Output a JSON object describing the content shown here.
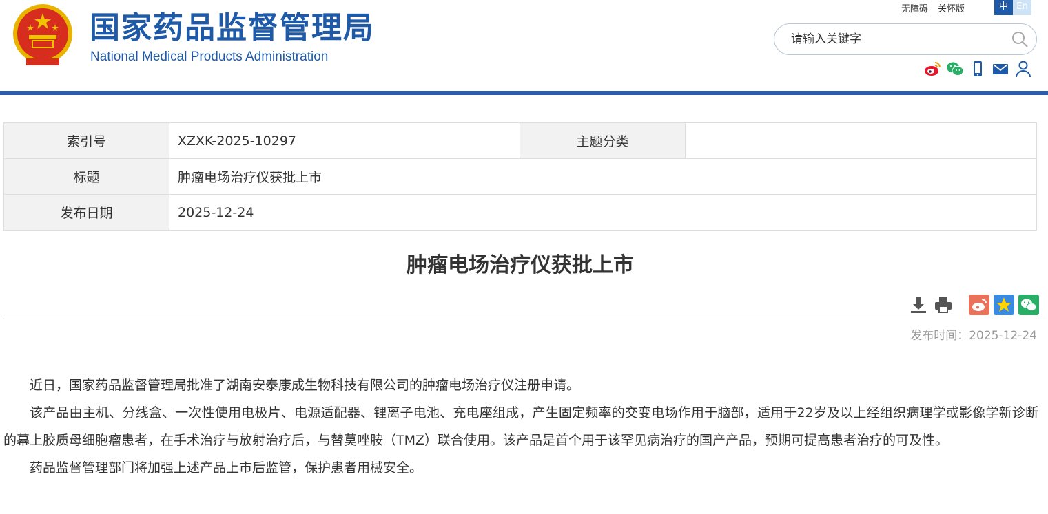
{
  "header": {
    "logo_cn": "国家药品监督管理局",
    "logo_en": "National Medical Products Administration",
    "links": {
      "accessibility": "无障碍",
      "elderly": "关怀版"
    },
    "lang": {
      "zh": "中",
      "en": "En"
    },
    "search": {
      "placeholder": "请输入关键字"
    },
    "social_icons": [
      "weibo-icon",
      "wechat-icon",
      "mobile-icon",
      "mail-icon",
      "user-icon"
    ]
  },
  "info": {
    "index_label": "索引号",
    "index_value": "XZXK-2025-10297",
    "topic_label": "主题分类",
    "topic_value": "",
    "title_label": "标题",
    "title_value": "肿瘤电场治疗仪获批上市",
    "date_label": "发布日期",
    "date_value": "2025-12-24"
  },
  "article": {
    "title": "肿瘤电场治疗仪获批上市",
    "pubtime": "发布时间：2025-12-24",
    "paragraphs": [
      "近日，国家药品监督管理局批准了湖南安泰康成生物科技有限公司的肿瘤电场治疗仪注册申请。",
      "该产品由主机、分线盒、一次性使用电极片、电源适配器、锂离子电池、充电座组成，产生固定频率的交变电场作用于脑部，适用于22岁及以上经组织病理学或影像学新诊断的幕上胶质母细胞瘤患者，在手术治疗与放射治疗后，与替莫唑胺（TMZ）联合使用。该产品是首个用于该罕见病治疗的国产产品，预期可提高患者治疗的可及性。",
      "药品监督管理部门将加强上述产品上市后监管，保护患者用械安全。"
    ]
  },
  "colors": {
    "brand_blue": "#1e5aa8",
    "bar_blue": "#2e5cad",
    "weibo_red": "#e6162d",
    "wechat_green": "#2aae67"
  }
}
